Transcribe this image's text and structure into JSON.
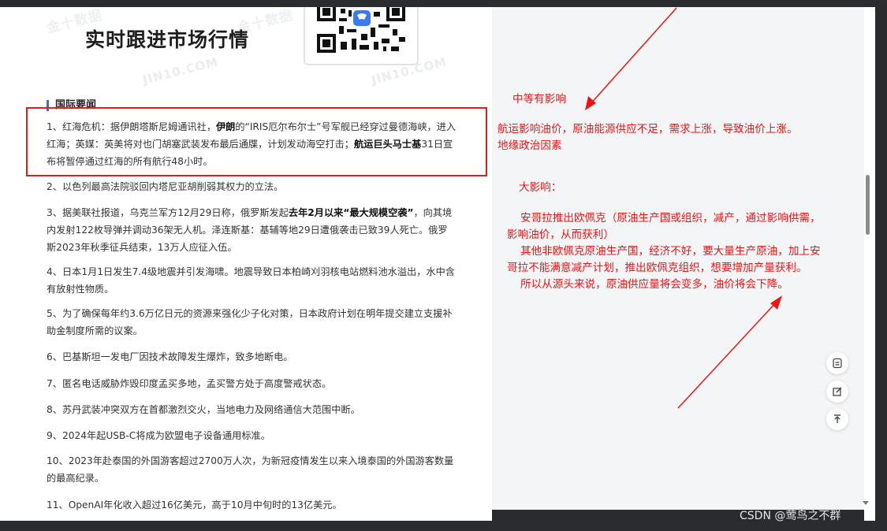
{
  "banner": {
    "title": "实时跟进市场行情",
    "watermark": "JIN10.COM",
    "watermark_logo": "金十数据"
  },
  "section_title": "国际要闻",
  "news": [
    {
      "prefix": "1、红海危机：据伊朗塔斯尼姆通讯社，",
      "bold1": "伊朗",
      "mid1": "的“IRIS厄尔布尔士”号军舰已经穿过曼德海峡，进入红海；英媒：英美将对也门胡塞武装发布最后通牒，计划发动海空打击；",
      "bold2": "航运巨头马士基",
      "suffix": "31日宣布将暂停通过红海的所有航行48小时。"
    },
    {
      "text": "2、以色列最高法院驳回内塔尼亚胡削弱其权力的立法。"
    },
    {
      "prefix": "3、据美联社报道，乌克兰军方12月29日称，俄罗斯发起",
      "bold1": "去年2月以来“最大规模空袭”",
      "suffix": "，向其境内发射122枚导弹并调动36架无人机。泽连斯基：基辅等地29日遭俄袭击已致39人死亡。俄罗斯2023年秋季征兵结束，13万人应征入伍。"
    },
    {
      "text": "4、日本1月1日发生7.4级地震并引发海啸。地震导致日本柏崎刈羽核电站燃料池水溢出，水中含有放射性物质。"
    },
    {
      "text": "5、为了确保每年约3.6万亿日元的资源来强化少子化对策，日本政府计划在明年提交建立支援补助金制度所需的议案。"
    },
    {
      "text": "6、巴基斯坦一发电厂因技术故障发生爆炸，致多地断电。"
    },
    {
      "text": "7、匿名电话威胁炸毁印度孟买多地，孟买警方处于高度警戒状态。"
    },
    {
      "text": "8、苏丹武装冲突双方在首都激烈交火，当地电力及网络通信大范围中断。"
    },
    {
      "text": "9、2024年起USB-C将成为欧盟电子设备通用标准。"
    },
    {
      "text": "10、2023年赴泰国的外国游客超过2700万人次，为新冠疫情发生以来入境泰国的外国游客数量的最高纪录。"
    },
    {
      "text": "11、OpenAI年化收入超过16亿美元，高于10月中旬时的13亿美元。"
    }
  ],
  "annotations": {
    "medium_title": "中等有影响",
    "medium_line1": "航运影响油价，原油能源供应不足，需求上涨，导致油价上涨。",
    "medium_line2": "地缘政治因素",
    "large_title": "大影响：",
    "large_line1": "安哥拉推出欧佩克（原油生产国或组织，减产，通过影响供需，",
    "large_line2": "影响油价，从而获利）",
    "large_line3": "其他非欧佩克原油生产国，经济不好，要大量生产原油，加上安",
    "large_line4": "哥拉不能满意减产计划，推出欧佩克组织，想要增加产量获利。",
    "large_line5": "所以从源头来说，原油供应量将会变多，油价将会下降。"
  },
  "colors": {
    "annotation": "#ee1414",
    "highlight_box": "#e01b1b",
    "section_bar": "#2f6fde"
  },
  "footer_watermark": "CSDN @莺鸟之不群",
  "icons": [
    "qr-code-icon",
    "share-card-icon",
    "edit-icon",
    "back-to-top-icon",
    "scroll-down-icon"
  ]
}
